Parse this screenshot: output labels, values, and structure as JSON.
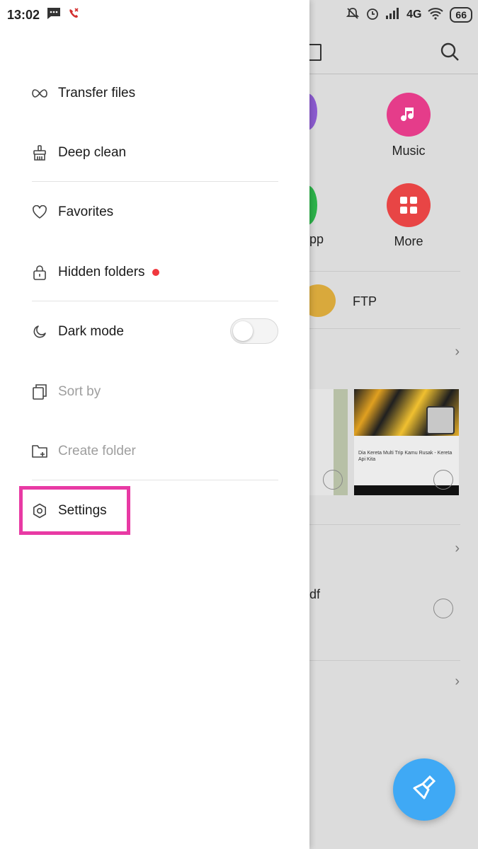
{
  "status_bar": {
    "time": "13:02",
    "network": "4G",
    "battery": "66"
  },
  "drawer": {
    "items": [
      {
        "label": "Transfer files",
        "icon": "infinity-icon",
        "enabled": true
      },
      {
        "label": "Deep clean",
        "icon": "broom-icon",
        "enabled": true
      },
      {
        "label": "Favorites",
        "icon": "heart-icon",
        "enabled": true
      },
      {
        "label": "Hidden folders",
        "icon": "lock-icon",
        "enabled": true,
        "badge": "red-dot"
      },
      {
        "label": "Dark mode",
        "icon": "moon-icon",
        "enabled": true,
        "toggle": "off"
      },
      {
        "label": "Sort by",
        "icon": "sort-icon",
        "enabled": false
      },
      {
        "label": "Create folder",
        "icon": "folder-plus-icon",
        "enabled": false
      },
      {
        "label": "Settings",
        "icon": "gear-icon",
        "enabled": true,
        "highlighted": true
      }
    ]
  },
  "background": {
    "categories": [
      {
        "label": "Music",
        "icon": "music-note-icon",
        "color": "#e53c8a"
      },
      {
        "label": "More",
        "icon": "grid-icon",
        "color": "#e84545"
      },
      {
        "label": "pp",
        "color": "#2db24a"
      }
    ],
    "ftp_label": "FTP",
    "pdf_fragment": "df",
    "thumbnail_caption": "Dia Kereta Multi Trip Kamu Rusak - Kereta Api Kita"
  },
  "colors": {
    "highlight": "#e83aa4",
    "fab": "#3fa9f5",
    "badge": "#f0383e"
  }
}
